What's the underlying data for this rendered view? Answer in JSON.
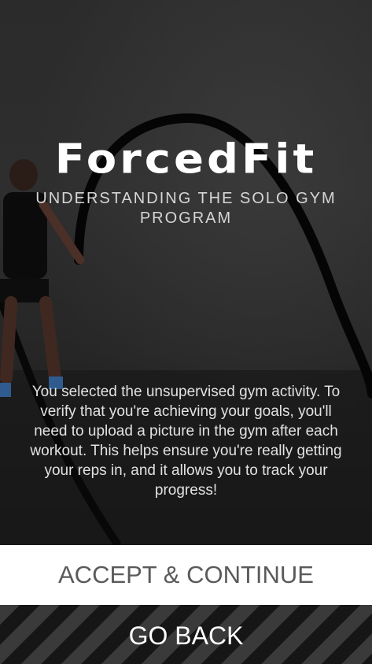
{
  "brand": {
    "name": "ForcedFit"
  },
  "header": {
    "subtitle": "UNDERSTANDING THE SOLO GYM PROGRAM"
  },
  "main": {
    "description": "You selected the unsupervised gym activity. To verify that you're achieving your goals, you'll need to upload a picture in the gym after each workout. This helps ensure you're really getting your reps in, and it allows you to track your progress!"
  },
  "actions": {
    "accept_label": "ACCEPT & CONTINUE",
    "back_label": "GO BACK"
  },
  "colors": {
    "accept_bg": "#ffffff",
    "accept_text": "#5a5a5a",
    "stripe_light": "#3a3a3a",
    "stripe_dark": "#161616"
  }
}
